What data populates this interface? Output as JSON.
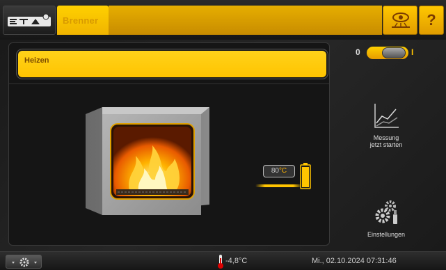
{
  "header": {
    "tab_label": "Brenner",
    "help_label": "?"
  },
  "main": {
    "status_text": "Heizen",
    "toggle": {
      "off_label": "0",
      "on_label": "I",
      "state": "on"
    },
    "temperature": {
      "value": "80",
      "unit": "°C"
    },
    "measure_button": {
      "line1": "Messung",
      "line2": "jetzt starten"
    },
    "settings_button": {
      "label": "Einstellungen"
    }
  },
  "footer": {
    "outside_temperature": "-4,8°C",
    "datetime": "Mi., 02.10.2024 07:31:46"
  },
  "colors": {
    "accent": "#ffc400",
    "background": "#1a1a1a",
    "status_text": "#7a4a00"
  }
}
